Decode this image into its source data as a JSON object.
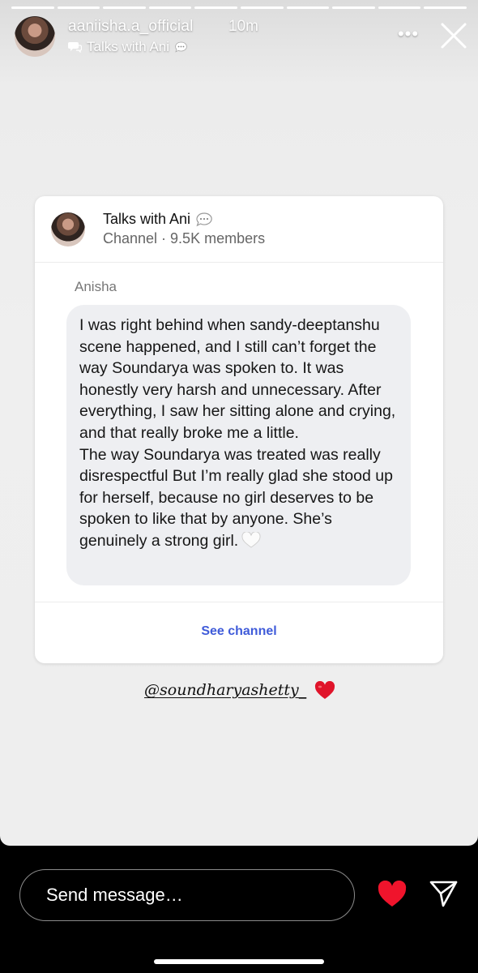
{
  "story": {
    "username": "aaniisha.a_official",
    "time": "10m",
    "channel_name": "Talks with Ani",
    "more_label": "•••",
    "progress_segments": 10
  },
  "card": {
    "title": "Talks with Ani",
    "meta": "Channel · 9.5K members",
    "sender": "Anisha",
    "message_p1": "I was right behind when sandy-deeptanshu scene happened, and I still can’t forget the way Soundarya was spoken to. It was honestly very harsh and unnecessary. After everything, I saw her sitting alone and crying, and that really broke me a little.",
    "message_p2": "The way Soundarya was treated was really disrespectful But I’m really glad she stood up for herself, because no girl deserves to be spoken to like that by anyone. She’s genuinely a strong girl.",
    "see_channel": "See channel"
  },
  "mention": "@soundharyashetty_",
  "bottom": {
    "input_placeholder": "Send message…"
  },
  "colors": {
    "link_blue": "#3f5bd9",
    "heart_red": "#e0142a",
    "bubble_bg": "#eeeff2"
  }
}
